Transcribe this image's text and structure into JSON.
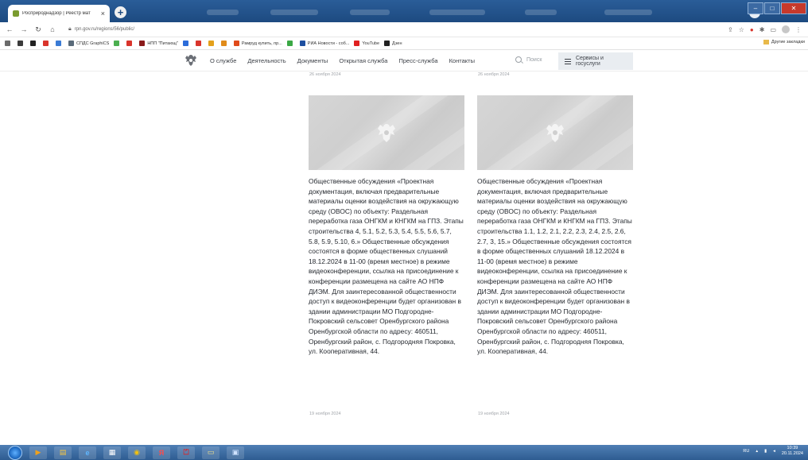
{
  "browser": {
    "tab_title": "Росприроднадзор | Реестр мат",
    "tab_close": "×",
    "new_tab": "+",
    "url": "rpn.gov.ru/regions/56/public/",
    "bookmarks": [
      {
        "label": "",
        "color": "#6b6b6b"
      },
      {
        "label": "",
        "color": "#3b3b3b"
      },
      {
        "label": "",
        "color": "#222222"
      },
      {
        "label": "",
        "color": "#d9342b"
      },
      {
        "label": "",
        "color": "#3a7bd5"
      },
      {
        "label": "СПДС GraphiCS",
        "color": "#5a6b7a"
      },
      {
        "label": "",
        "color": "#4caf50"
      },
      {
        "label": "",
        "color": "#d9342b"
      },
      {
        "label": "НПП \"Питающ\"",
        "color": "#8a1a1a"
      },
      {
        "label": "",
        "color": "#2b6cd9"
      },
      {
        "label": "",
        "color": "#d9342b"
      },
      {
        "label": "",
        "color": "#e4a11b"
      },
      {
        "label": "",
        "color": "#e08b1a"
      },
      {
        "label": "Рамруд купить, пр...",
        "color": "#e04a1a"
      },
      {
        "label": "",
        "color": "#3aa845"
      },
      {
        "label": "РИА Новости - соб...",
        "color": "#1e4fa0"
      },
      {
        "label": "YouTube",
        "color": "#e02020"
      },
      {
        "label": "Дзен",
        "color": "#222222"
      }
    ],
    "other_bookmarks": "Другие закладки"
  },
  "site": {
    "nav": [
      "О службе",
      "Деятельность",
      "Документы",
      "Открытая служба",
      "Пресс-служба",
      "Контакты"
    ],
    "search_placeholder": "Поиск",
    "services_label": "Сервисы и госуслуги"
  },
  "cards": [
    {
      "date_top": "26 ноября 2024",
      "text": "Общественные обсуждения «Проектная документация, включая предварительные материалы оценки воздействия на окружающую среду (ОВОС) по объекту: Раздельная переработка газа ОНГКМ и КНГКМ на ГПЗ. Этапы строительства 4, 5.1, 5.2, 5.3, 5.4, 5.5, 5.6, 5.7, 5.8, 5.9, 5.10, 6.» Общественные обсуждения состоятся в форме общественных слушаний 18.12.2024 в 11-00 (время местное) в режиме видеоконференции, ссылка на присоединение к конференции размещена на сайте АО НПФ ДИЭМ. Для заинтересованной общественности доступ к видеоконференции будет организован в здании администрации МО Подгородне-Покровский сельсовет Оренбургского района Оренбургской области по адресу: 460511, Оренбургский район, с. Подгородняя Покровка, ул. Кооперативная, 44.",
      "date": "19 ноября 2024"
    },
    {
      "date_top": "26 ноября 2024",
      "text": "Общественные обсуждения «Проектная документация, включая предварительные материалы оценки воздействия на окружающую среду (ОВОС) по объекту: Раздельная переработка газа ОНГКМ и КНГКМ на ГПЗ. Этапы строительства 1.1, 1.2, 2.1, 2.2, 2.3, 2.4, 2.5, 2.6, 2.7, 3, 15.» Общественные обсуждения состоятся в форме общественных слушаний 18.12.2024 в 11-00 (время местное) в режиме видеоконференции, ссылка на присоединение к конференции размещена на сайте АО НПФ ДИЭМ. Для заинтересованной общественности доступ к видеоконференции будет организован в здании администрации МО Подгородне-Покровский сельсовет Оренбургского района Оренбургской области по адресу: 460511, Оренбургский район, с. Подгородняя Покровка, ул. Кооперативная, 44.",
      "date": "19 ноября 2024"
    }
  ],
  "taskbar": {
    "tray_lang": "RU",
    "time": "10:39",
    "date": "20.11.2024"
  }
}
